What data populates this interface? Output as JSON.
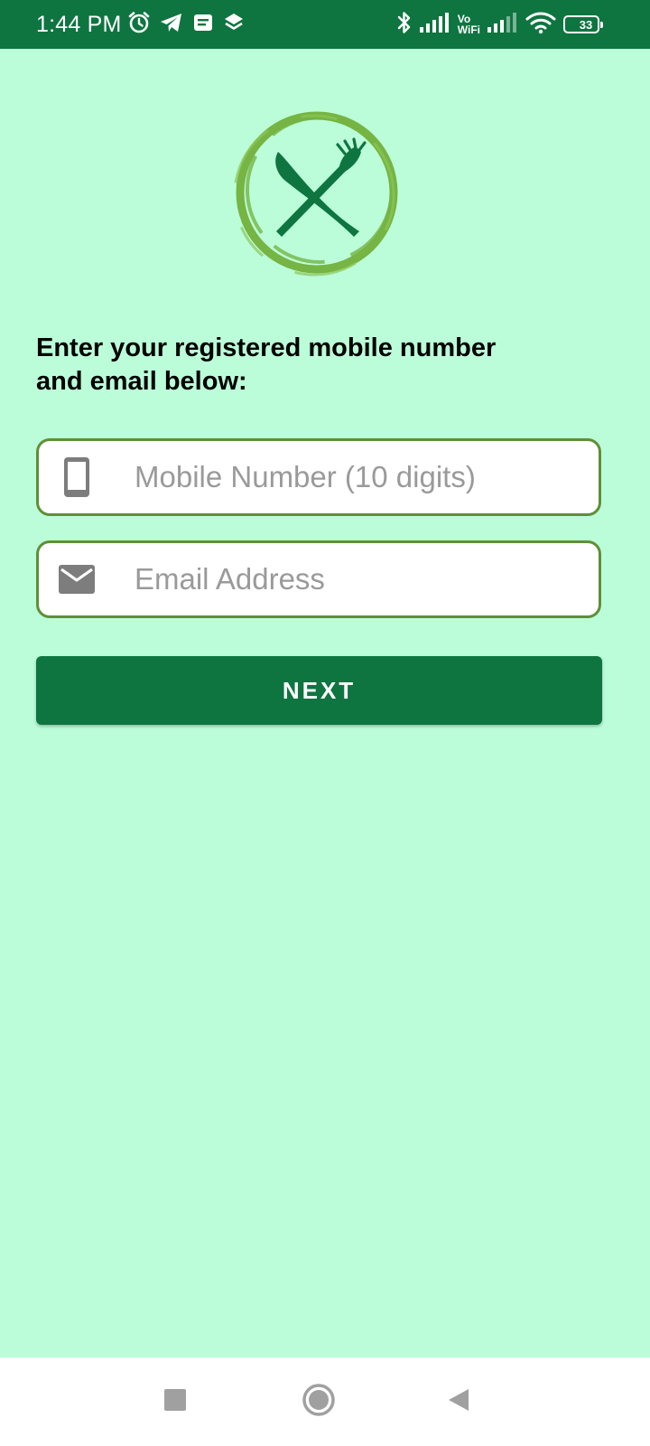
{
  "colors": {
    "status_bar": "#0e7540",
    "background": "#bbfdd9",
    "field_border": "#5f8f37",
    "button": "#0e7540",
    "logo_ring": "#76b443",
    "logo_utensils": "#0e7540",
    "icon_gray": "#7d7d7d",
    "nav_icon": "#a0a0a0"
  },
  "status_bar": {
    "time": "1:44 PM",
    "left_icons": [
      "alarm-icon",
      "telegram-icon",
      "message-icon",
      "stack-icon"
    ],
    "right_icons": [
      "bluetooth-icon",
      "signal-icon",
      "vowifi-icon",
      "signal-icon",
      "wifi-icon",
      "battery-icon"
    ],
    "vowifi_top": "Vo",
    "vowifi_bottom": "WiFi",
    "battery_level": "33",
    "battery_fraction": 0.33
  },
  "main": {
    "logo_icon": "fork-knife-logo-icon",
    "instruction": "Enter your registered mobile number and email below:",
    "mobile": {
      "icon": "phone-icon",
      "placeholder": "Mobile Number (10 digits)",
      "value": ""
    },
    "email": {
      "icon": "email-icon",
      "placeholder": "Email Address",
      "value": ""
    },
    "next_label": "NEXT"
  },
  "nav_bar": {
    "icons": [
      "recents-icon",
      "home-icon",
      "back-icon"
    ]
  }
}
